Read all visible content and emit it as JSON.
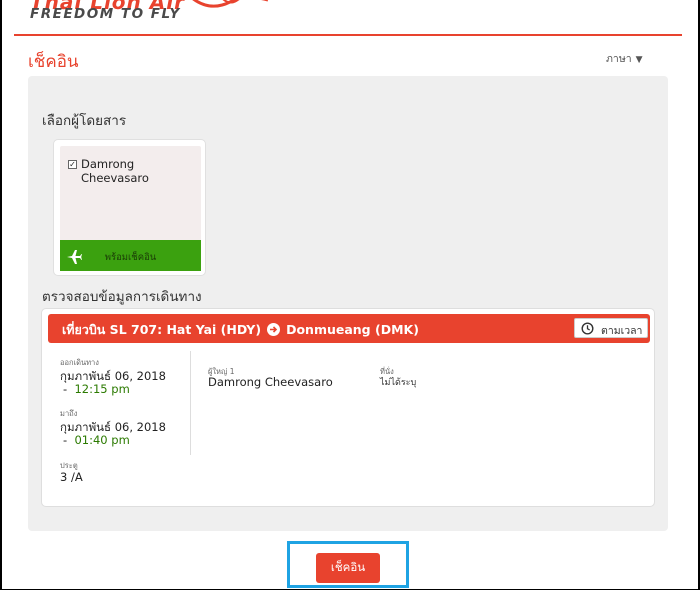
{
  "brand": {
    "logo_text": "Thai Lion Air",
    "tagline": "FREEDOM TO FLY",
    "accent_color": "#e8432e"
  },
  "header": {
    "page_title": "เช็คอิน",
    "language_label": "ภาษา",
    "language_caret": "▼"
  },
  "select_passenger": {
    "heading": "เลือกผู้โดยสาร",
    "passengers": [
      {
        "name": "Damrong Cheevasaro",
        "checked": true,
        "status": "พร้อมเช็คอิน",
        "status_icon": "plane-icon",
        "status_color": "#3ba10f"
      }
    ]
  },
  "review": {
    "heading": "ตรวจสอบข้อมูลการเดินทาง",
    "flight": {
      "prefix": "เที่ยวบิน SL 707:",
      "origin": "Hat Yai (HDY)",
      "destination": "Donmueang (DMK)",
      "track_label": "ตามเวลา",
      "track_icon": "clock-icon",
      "departure_label": "ออกเดินทาง",
      "departure_date": "กุมภาพันธ์ 06, 2018",
      "departure_time": "12:15 pm",
      "arrival_label": "มาถึง",
      "arrival_date": "กุมภาพันธ์ 06, 2018",
      "arrival_time": "01:40 pm",
      "gate_label": "ประตู",
      "gate_value": "3 /A",
      "passenger_label": "ผู้ใหญ่ 1",
      "passenger_name": "Damrong Cheevasaro",
      "seat_label": "ที่นั่ง",
      "seat_value": "ไม่ได้ระบุ",
      "time_color": "#2b7a00"
    }
  },
  "actions": {
    "checkin_button": "เช็คอิน",
    "highlight_color": "#1fa3e3"
  }
}
